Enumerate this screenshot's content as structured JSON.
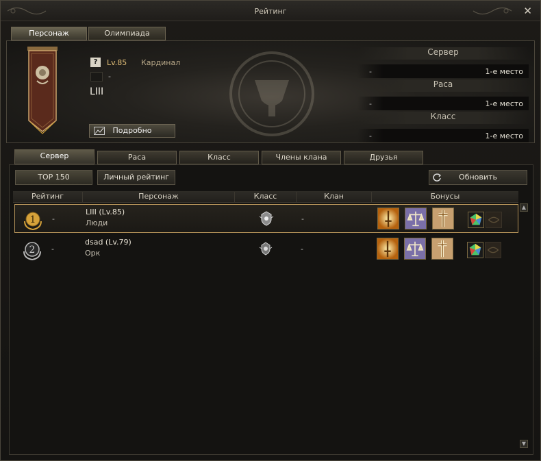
{
  "window": {
    "title": "Рейтинг",
    "close_label": "✕"
  },
  "top_tabs": [
    {
      "label": "Персонаж",
      "active": true
    },
    {
      "label": "Олимпиада",
      "active": false
    }
  ],
  "profile": {
    "help_label": "?",
    "level": "Lv.85",
    "class_name": "Кардинал",
    "clan": "-",
    "name": "LIII",
    "details_label": "Подробно"
  },
  "rankings": [
    {
      "header": "Сервер",
      "dash": "-",
      "value": "1-е место"
    },
    {
      "header": "Раса",
      "dash": "-",
      "value": "1-е место"
    },
    {
      "header": "Класс",
      "dash": "-",
      "value": "1-е место"
    }
  ],
  "sub_tabs": [
    {
      "label": "Сервер",
      "active": true
    },
    {
      "label": "Раса",
      "active": false
    },
    {
      "label": "Класс",
      "active": false
    },
    {
      "label": "Члены клана",
      "active": false
    },
    {
      "label": "Друзья",
      "active": false
    }
  ],
  "filters": {
    "top_label": "TOP 150",
    "personal_label": "Личный рейтинг",
    "refresh_label": "Обновить"
  },
  "table": {
    "columns": [
      "Рейтинг",
      "Персонаж",
      "Класс",
      "Клан",
      "Бонусы"
    ],
    "rows": [
      {
        "rank": "1",
        "rank_change": "-",
        "name": "LIII (Lv.85)",
        "race": "Люди",
        "clan": "-",
        "medal_color": "#d6a23a"
      },
      {
        "rank": "2",
        "rank_change": "-",
        "name": "dsad (Lv.79)",
        "race": "Орк",
        "clan": "-",
        "medal_color": "#b9b9b9"
      }
    ]
  },
  "colors": {
    "gold": "#e6c27a",
    "selected_border": "#b6945a"
  }
}
